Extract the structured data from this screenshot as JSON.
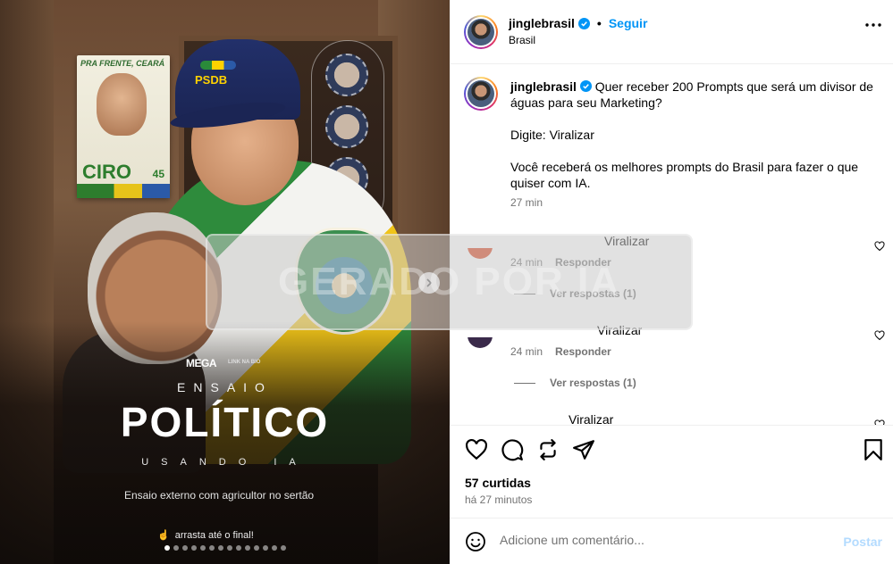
{
  "post": {
    "username": "jinglebrasil",
    "follow_label": "Seguir",
    "location": "Brasil",
    "separator": "•"
  },
  "media": {
    "poster_header": "PRA FRENTE, CEARÁ",
    "poster_name": "CIRO",
    "poster_number": "45",
    "cap_logo": "PSDB",
    "brand": "MEGA",
    "brand_sub": "LINK NA BIO",
    "title_top": "ENSAIO",
    "title_main": "POLÍTICO",
    "title_bottom": "USANDO IA",
    "subtitle": "Ensaio externo com agricultor no sertão",
    "swipe_text": "arrasta até o final!",
    "slide_count": 14,
    "active_slide": 1
  },
  "caption": {
    "username": "jinglebrasil",
    "line1": "Quer receber 200 Prompts que será um divisor de águas para seu Marketing?",
    "line2": "Digite: Viralizar",
    "line3": "Você receberá os melhores prompts do Brasil para fazer o que quiser com IA.",
    "time": "27 min"
  },
  "comments": [
    {
      "text": "Viralizar",
      "time": "24 min",
      "reply_label": "Responder",
      "replies_label": "Ver respostas (1)"
    },
    {
      "text": "Viralizar",
      "time": "24 min",
      "reply_label": "Responder",
      "replies_label": "Ver respostas (1)"
    },
    {
      "text": "Viralizar"
    }
  ],
  "watermark": "GERADO POR IA",
  "stats": {
    "likes": "57 curtidas",
    "when": "há 27 minutos"
  },
  "composer": {
    "placeholder": "Adicione um comentário...",
    "post_label": "Postar"
  },
  "colors": {
    "link_blue": "#0095f6",
    "post_disabled": "#b3dbff",
    "muted": "#737373"
  },
  "icons": [
    "more-icon",
    "verified-icon",
    "heart-icon",
    "comment-icon",
    "repost-icon",
    "share-icon",
    "bookmark-icon",
    "emoji-icon",
    "chevron-right-icon"
  ]
}
